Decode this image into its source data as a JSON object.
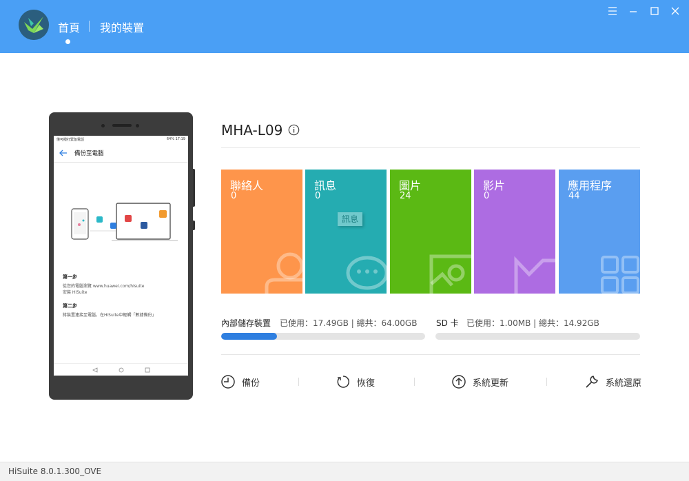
{
  "header": {
    "nav_home": "首頁",
    "nav_device": "我的裝置",
    "accent_color": "#4a9ff5"
  },
  "window_controls": [
    "menu-icon",
    "minimize-icon",
    "maximize-icon",
    "close-icon"
  ],
  "phone_screen": {
    "status_left": "僅可撥打緊急電話",
    "status_right": "64%  17:19",
    "title": "備份至電腦",
    "step1_title": "第一步",
    "step1_line1": "從您的電腦瀏覽 www.huawei.com/hisuite",
    "step1_line2": "安裝 HiSuite",
    "step2_title": "第二步",
    "step2_line1": "將裝置連接至電腦，在HiSuite中輕觸「數據備份」",
    "bubble_text": "訊息"
  },
  "device": {
    "name": "MHA-L09"
  },
  "tiles": [
    {
      "name": "聯絡人",
      "count": "0",
      "color": "#fe954b"
    },
    {
      "name": "訊息",
      "count": "0",
      "color": "#25acb1"
    },
    {
      "name": "圖片",
      "count": "24",
      "color": "#5bb914"
    },
    {
      "name": "影片",
      "count": "0",
      "color": "#ad6ce2"
    },
    {
      "name": "應用程序",
      "count": "44",
      "color": "#5a9ef0"
    }
  ],
  "tile_overlay_text": "訊息",
  "storage": {
    "internal_label": "內部儲存裝置",
    "internal_value": "已使用：17.49GB | 總共：64.00GB",
    "internal_used_fraction": 0.273,
    "sd_label": "SD 卡",
    "sd_value": "已使用：1.00MB | 總共：14.92GB",
    "sd_used_fraction": 0.0
  },
  "actions": [
    {
      "label": "備份",
      "icon": "backup-icon"
    },
    {
      "label": "恢復",
      "icon": "restore-icon"
    },
    {
      "label": "系統更新",
      "icon": "update-icon"
    },
    {
      "label": "系統還原",
      "icon": "wrench-icon"
    }
  ],
  "footer": {
    "version": "HiSuite 8.0.1.300_OVE"
  }
}
